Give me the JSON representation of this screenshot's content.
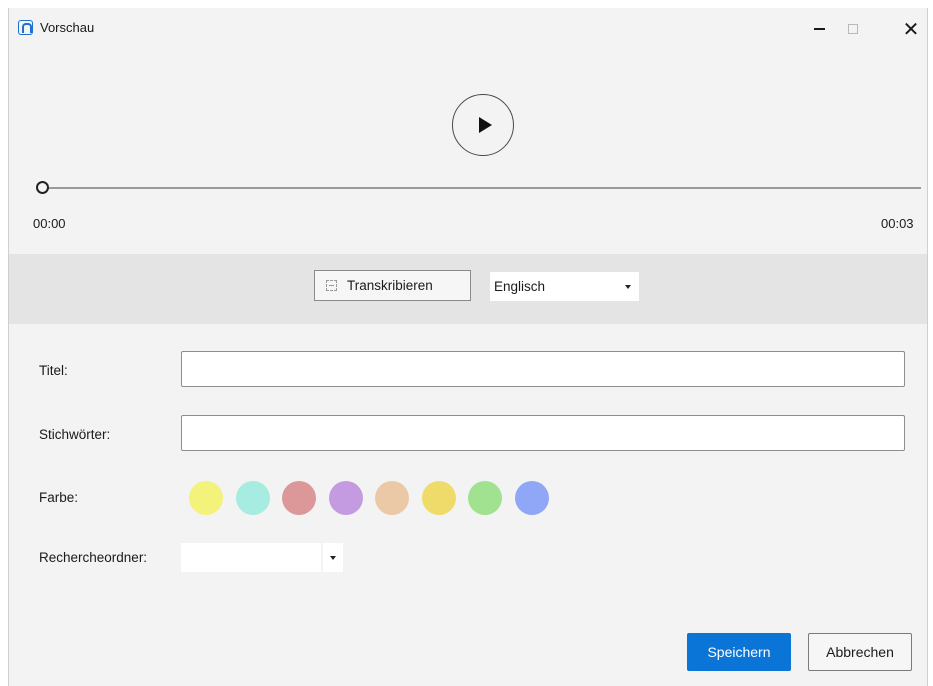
{
  "window": {
    "title": "Vorschau",
    "icon": "app-logo-icon",
    "controls": [
      "minimize-icon",
      "maximize-icon",
      "close-icon"
    ],
    "close_glyph": "✕"
  },
  "player": {
    "play_icon": "play-icon",
    "time_current": "00:00",
    "time_total": "00:03",
    "progress": 0
  },
  "transcribe": {
    "button_label": "Transkribieren",
    "button_icon": "transcribe-icon",
    "language": {
      "selected": "Englisch"
    }
  },
  "form": {
    "title_label": "Titel:",
    "title_value": "",
    "keywords_label": "Stichwörter:",
    "keywords_value": "",
    "color_label": "Farbe:",
    "colors": [
      {
        "name": "yellow",
        "hex": "#f3f27a"
      },
      {
        "name": "mint",
        "hex": "#a6ece0"
      },
      {
        "name": "rose",
        "hex": "#dc9898"
      },
      {
        "name": "lavender",
        "hex": "#c49be0"
      },
      {
        "name": "peach",
        "hex": "#ecc9a6"
      },
      {
        "name": "gold",
        "hex": "#eedb6a"
      },
      {
        "name": "green",
        "hex": "#a0e290"
      },
      {
        "name": "blue",
        "hex": "#8fa7f6"
      }
    ],
    "folder_label": "Rechercheordner:",
    "folder_value": ""
  },
  "actions": {
    "save_label": "Speichern",
    "cancel_label": "Abbrechen"
  },
  "theme": {
    "accent": "#0a75d6",
    "background": "#f3f3f3",
    "band": "#e4e4e4"
  }
}
